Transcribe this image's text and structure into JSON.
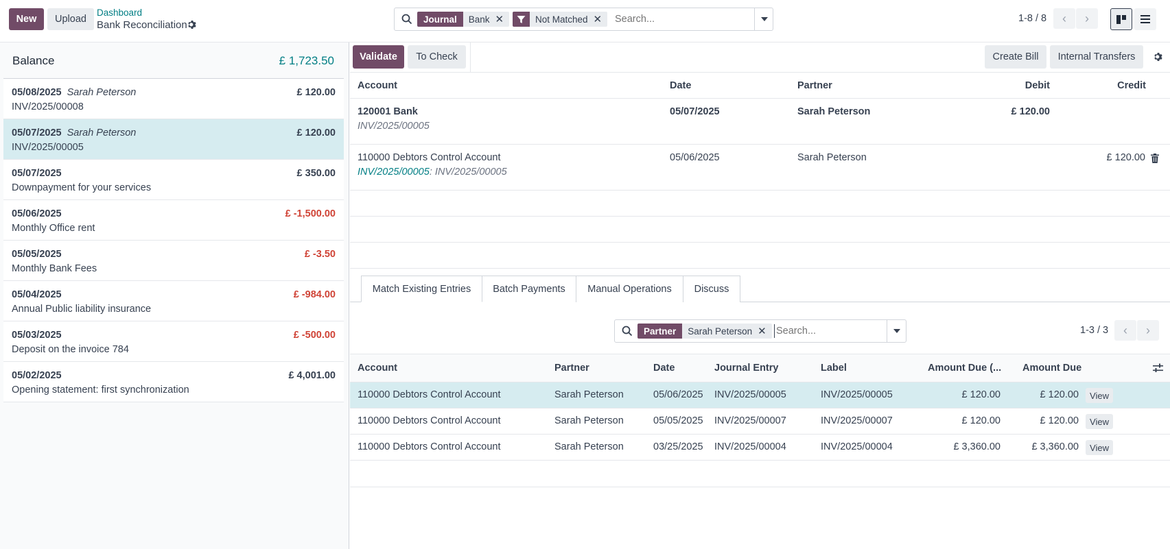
{
  "header": {
    "new_label": "New",
    "upload_label": "Upload",
    "breadcrumb_parent": "Dashboard",
    "page_title": "Bank Reconciliation",
    "search": {
      "facets": [
        {
          "key": "Journal",
          "value": "Bank"
        },
        {
          "key": "filter-icon",
          "value": "Not Matched"
        }
      ],
      "placeholder": "Search..."
    },
    "pager": "1-8 / 8"
  },
  "balance": {
    "label": "Balance",
    "amount": "£ 1,723.50"
  },
  "statements": [
    {
      "date": "05/08/2025",
      "partner": "Sarah Peterson",
      "label": "INV/2025/00008",
      "amount": "£ 120.00",
      "negative": false,
      "selected": false
    },
    {
      "date": "05/07/2025",
      "partner": "Sarah Peterson",
      "label": "INV/2025/00005",
      "amount": "£ 120.00",
      "negative": false,
      "selected": true
    },
    {
      "date": "05/07/2025",
      "partner": "",
      "label": "Downpayment for your services",
      "amount": "£ 350.00",
      "negative": false,
      "selected": false
    },
    {
      "date": "05/06/2025",
      "partner": "",
      "label": "Monthly Office rent",
      "amount": "£ -1,500.00",
      "negative": true,
      "selected": false
    },
    {
      "date": "05/05/2025",
      "partner": "",
      "label": "Monthly Bank Fees",
      "amount": "£ -3.50",
      "negative": true,
      "selected": false
    },
    {
      "date": "05/04/2025",
      "partner": "",
      "label": "Annual Public liability insurance",
      "amount": "£ -984.00",
      "negative": true,
      "selected": false
    },
    {
      "date": "05/03/2025",
      "partner": "",
      "label": "Deposit on the invoice 784",
      "amount": "£ -500.00",
      "negative": true,
      "selected": false
    },
    {
      "date": "05/02/2025",
      "partner": "",
      "label": "Opening statement: first synchronization",
      "amount": "£ 4,001.00",
      "negative": false,
      "selected": false
    }
  ],
  "actions": {
    "validate": "Validate",
    "to_check": "To Check",
    "create_bill": "Create Bill",
    "internal_transfers": "Internal Transfers"
  },
  "lines_table": {
    "headers": {
      "account": "Account",
      "date": "Date",
      "partner": "Partner",
      "debit": "Debit",
      "credit": "Credit"
    },
    "rows": [
      {
        "account": "120001 Bank",
        "sub": "INV/2025/00005",
        "date": "05/07/2025",
        "partner": "Sarah Peterson",
        "debit": "£ 120.00",
        "credit": ""
      },
      {
        "account": "110000 Debtors Control Account",
        "sub_link": "INV/2025/00005",
        "sub_sep": ": ",
        "sub": "INV/2025/00005",
        "date": "05/06/2025",
        "partner": "Sarah Peterson",
        "debit": "",
        "credit": "£ 120.00"
      }
    ]
  },
  "tabs": [
    "Match Existing Entries",
    "Batch Payments",
    "Manual Operations",
    "Discuss"
  ],
  "match": {
    "search": {
      "facet_key": "Partner",
      "facet_value": "Sarah Peterson",
      "placeholder": "Search..."
    },
    "pager": "1-3 / 3",
    "headers": {
      "account": "Account",
      "partner": "Partner",
      "date": "Date",
      "journal_entry": "Journal Entry",
      "label": "Label",
      "amount_due_currency": "Amount Due (...",
      "amount_due": "Amount Due"
    },
    "view_label": "View",
    "rows": [
      {
        "account": "110000 Debtors Control Account",
        "partner": "Sarah Peterson",
        "date": "05/06/2025",
        "journal_entry": "INV/2025/00005",
        "label": "INV/2025/00005",
        "amount_due_currency": "£ 120.00",
        "amount_due": "£ 120.00",
        "selected": true
      },
      {
        "account": "110000 Debtors Control Account",
        "partner": "Sarah Peterson",
        "date": "05/05/2025",
        "journal_entry": "INV/2025/00007",
        "label": "INV/2025/00007",
        "amount_due_currency": "£ 120.00",
        "amount_due": "£ 120.00",
        "selected": false
      },
      {
        "account": "110000 Debtors Control Account",
        "partner": "Sarah Peterson",
        "date": "03/25/2025",
        "journal_entry": "INV/2025/00004",
        "label": "INV/2025/00004",
        "amount_due_currency": "£ 3,360.00",
        "amount_due": "£ 3,360.00",
        "selected": false
      }
    ]
  },
  "colors": {
    "brand": "#714b67",
    "link": "#017e84",
    "negative": "#d04437",
    "selected_row": "#d6ecf0"
  }
}
